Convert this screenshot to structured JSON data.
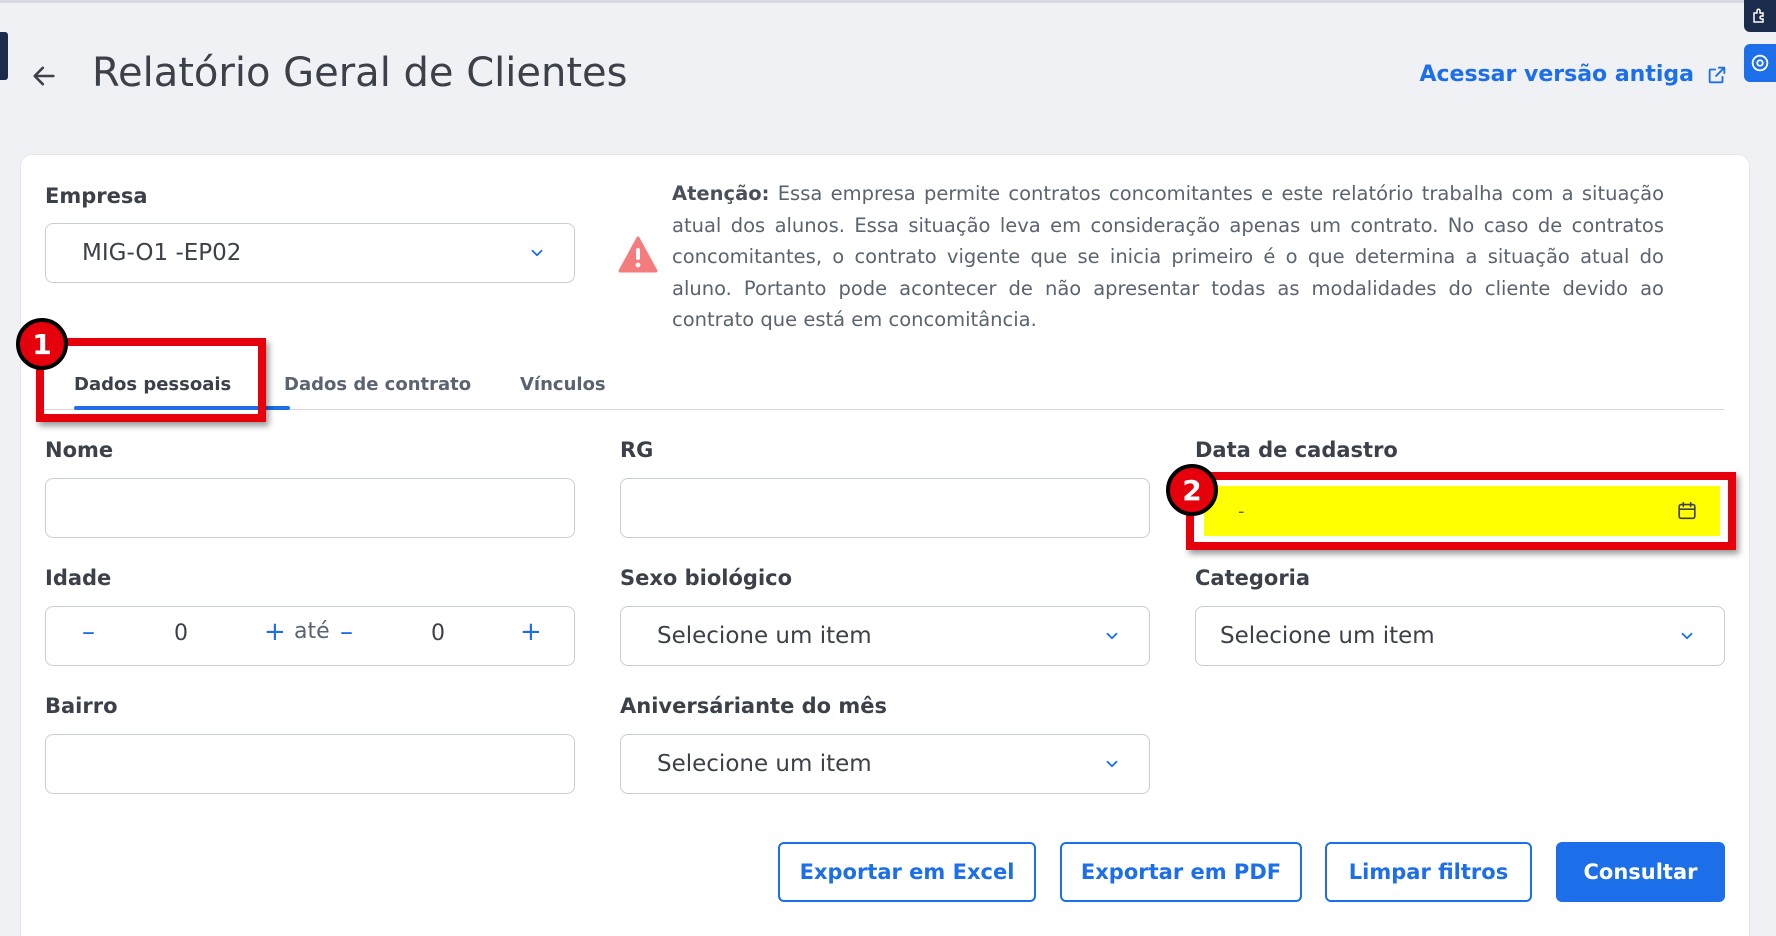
{
  "header": {
    "title": "Relatório Geral de Clientes",
    "old_version_link": "Acessar versão antiga"
  },
  "empresa": {
    "label": "Empresa",
    "value": "MIG-O1 -EP02"
  },
  "warning": {
    "prefix": "Atenção:",
    "text": " Essa empresa permite contratos concomitantes e este relatório trabalha com a situação atual dos alunos. Essa situação leva em consideração apenas um contrato. No caso de contratos concomitantes, o contrato vigente que se inicia primeiro é o que determina a situação atual do aluno. Portanto pode acontecer de não apresentar todas as modalidades do cliente devido ao contrato que está em concomitância."
  },
  "tabs": [
    {
      "label": "Dados pessoais"
    },
    {
      "label": "Dados de contrato"
    },
    {
      "label": "Vínculos"
    }
  ],
  "fields": {
    "nome": {
      "label": "Nome",
      "value": ""
    },
    "rg": {
      "label": "RG",
      "value": ""
    },
    "data_cadastro": {
      "label": "Data de cadastro",
      "value": "-"
    },
    "idade": {
      "label": "Idade",
      "min": "0",
      "max": "0",
      "separator": "até"
    },
    "sexo": {
      "label": "Sexo biológico",
      "value": "Selecione um item"
    },
    "categoria": {
      "label": "Categoria",
      "value": "Selecione um item"
    },
    "bairro": {
      "label": "Bairro",
      "value": ""
    },
    "aniversariante": {
      "label": "Aniversáriante do mês",
      "value": "Selecione um item"
    }
  },
  "buttons": {
    "excel": "Exportar em Excel",
    "pdf": "Exportar em PDF",
    "limpar": "Limpar filtros",
    "consultar": "Consultar"
  },
  "annotations": [
    {
      "number": "1"
    },
    {
      "number": "2"
    }
  ],
  "colors": {
    "accent": "#1c6fe8",
    "annotation": "#e6000c",
    "highlight": "#ffff00",
    "warning": "#f47c7c"
  }
}
